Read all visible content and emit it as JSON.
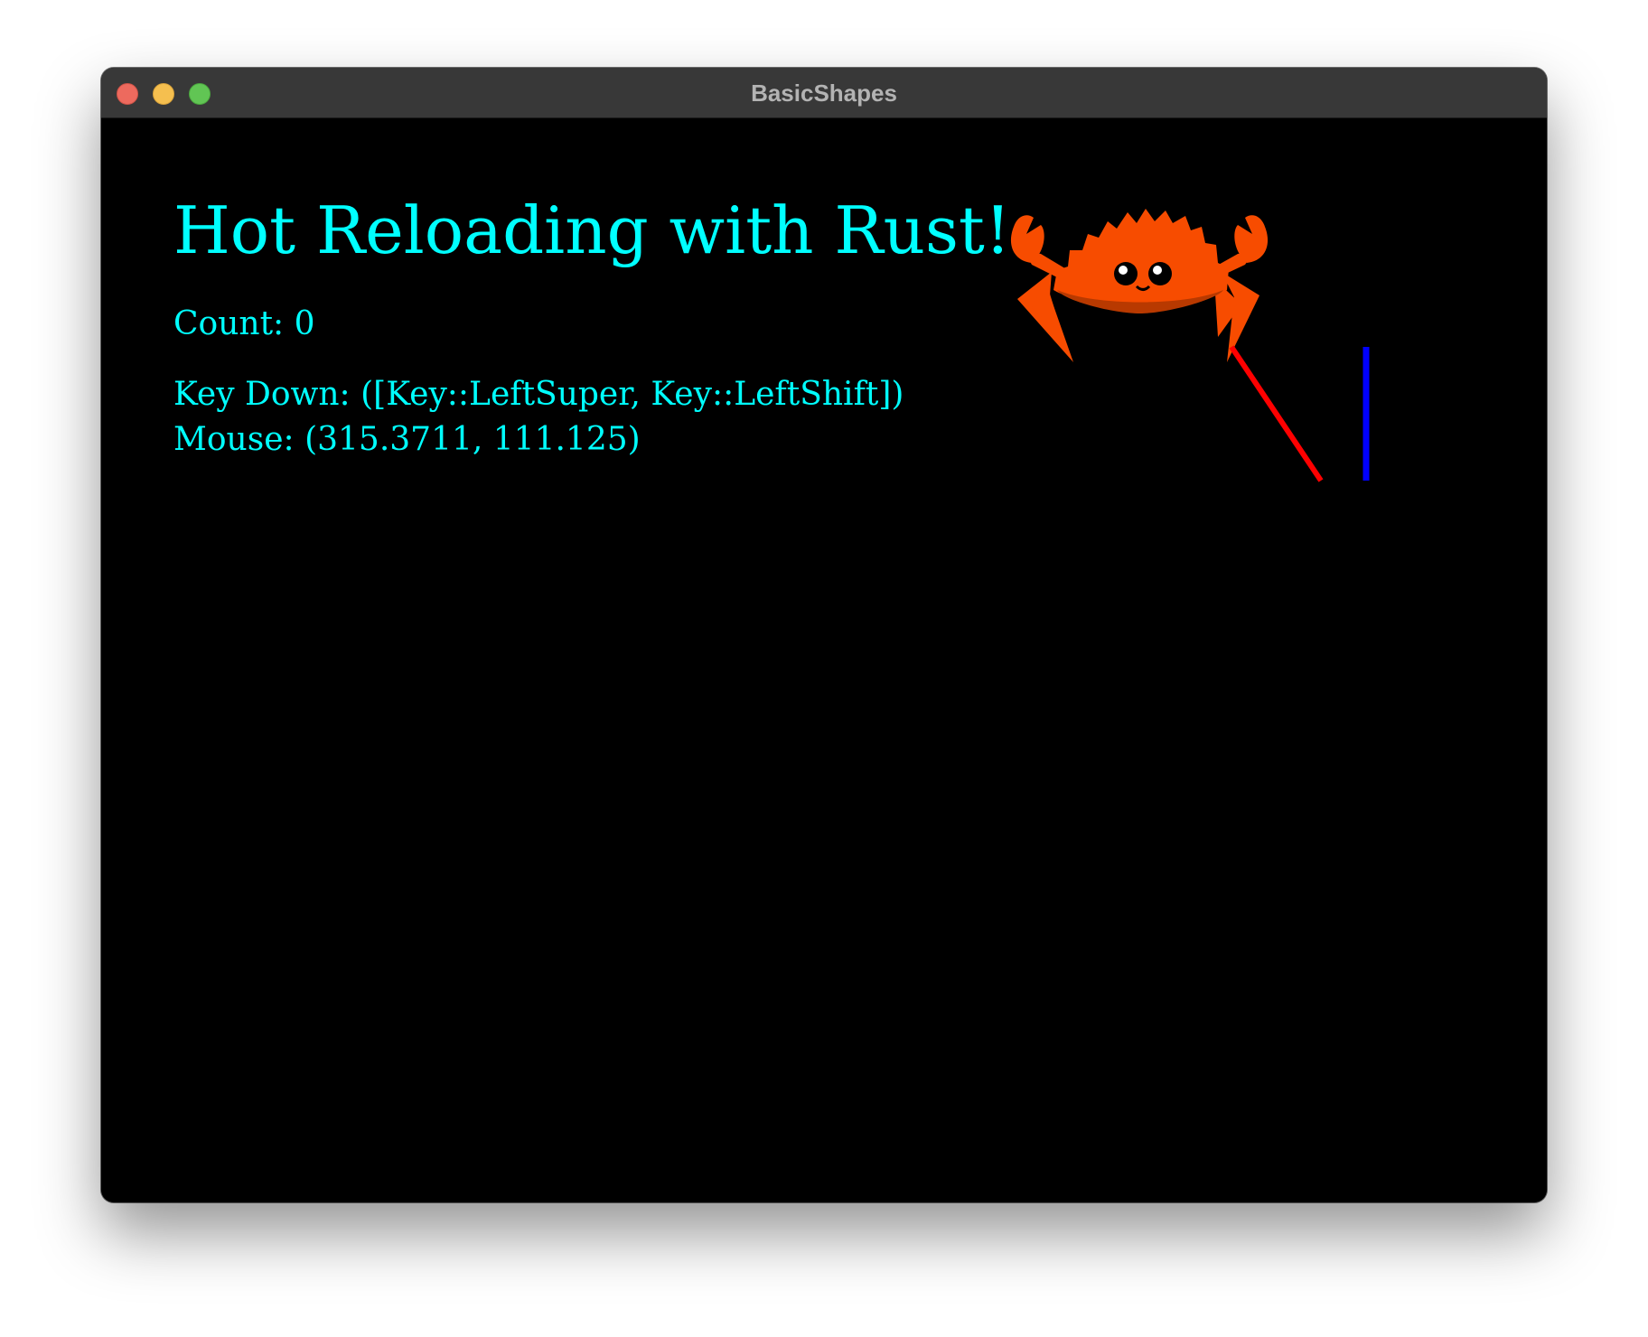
{
  "window": {
    "title": "BasicShapes"
  },
  "canvas": {
    "heading": "Hot Reloading with Rust!",
    "count_text": "Count: 0",
    "key_down_text": "Key Down: ([Key::LeftSuper, Key::LeftShift])",
    "mouse_text": "Mouse: (315.3711, 111.125)"
  },
  "colors": {
    "text": "#00ffff",
    "background": "#000000",
    "crab": "#f74c00",
    "red_line": "#ff0000",
    "blue_line": "#0000ff",
    "titlebar": "#383838"
  }
}
